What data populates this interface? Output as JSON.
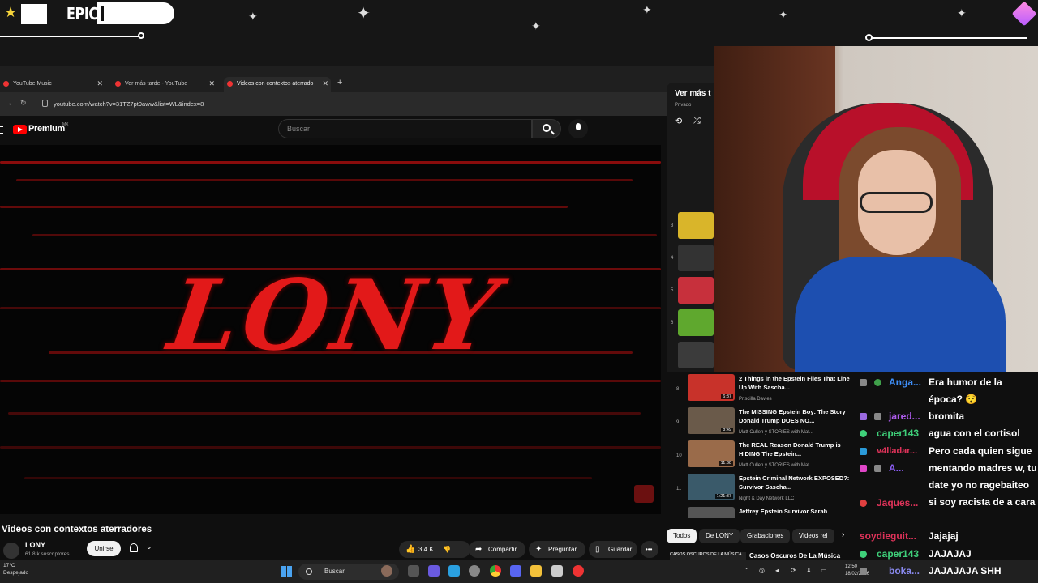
{
  "overlay": {
    "brand": "EPIC"
  },
  "browser": {
    "tabs": [
      {
        "label": "YouTube Music"
      },
      {
        "label": "Ver más tarde - YouTube"
      },
      {
        "label": "Videos con contextos aterrado"
      }
    ],
    "url": "youtube.com/watch?v=31TZ7pt9aww&list=WL&index=8"
  },
  "youtube": {
    "logo_text": "Premium",
    "region": "MX",
    "search_placeholder": "Buscar",
    "video_art_text": "LONY",
    "video_title": "Videos con contextos aterradores",
    "channel_name": "LONY",
    "channel_subs": "61.8 k suscriptores",
    "join_label": "Unirse",
    "actions": {
      "likes": "3.4 K",
      "share": "Compartir",
      "ask": "Preguntar",
      "save": "Guardar"
    }
  },
  "playlist": {
    "title": "Ver más t",
    "subtitle": "Privado",
    "items": [
      {
        "num": "3",
        "color": "#d9b52a"
      },
      {
        "num": "4",
        "color": "#333333"
      },
      {
        "num": "5",
        "color": "#c7303c"
      },
      {
        "num": "6",
        "color": "#5fa82e"
      },
      {
        "num": "",
        "color": "#3b3b3b"
      }
    ]
  },
  "recommendations": [
    {
      "num": "8",
      "title": "2 Things in the Epstein Files That Line Up With Sascha...",
      "channel": "Priscilla Davies",
      "duration": "6:37",
      "color": "#c8322a"
    },
    {
      "num": "9",
      "title": "The MISSING Epstein Boy: The Story Donald Trump DOES NO...",
      "channel": "Matt Cullen y STORIES with Mat...",
      "duration": "8:49",
      "color": "#6a5a4a"
    },
    {
      "num": "10",
      "title": "The REAL Reason Donald Trump is HIDING The Epstein...",
      "channel": "Matt Cullen y STORIES with Mat...",
      "duration": "11:30",
      "color": "#9a6b4a"
    },
    {
      "num": "11",
      "title": "Epstein Criminal Network EXPOSED?: Survivor Sascha...",
      "channel": "Night & Day Network LLC",
      "duration": "1:21:37",
      "color": "#3a5a6a"
    },
    {
      "num": "",
      "title": "Jeffrey Epstein Survivor Sarah",
      "channel": "",
      "duration": "",
      "color": "#555555"
    }
  ],
  "chips": [
    {
      "label": "Todos",
      "active": true
    },
    {
      "label": "De LONY",
      "active": false
    },
    {
      "label": "Grabaciones",
      "active": false
    },
    {
      "label": "Videos rel",
      "active": false
    }
  ],
  "bottom_rec": {
    "thumb_text": "CASOS OSCUROS DE LA MÚSICA",
    "title": "Casos Oscuros De La Música"
  },
  "chat": [
    {
      "user": "Anga...",
      "color": "#3e8ef7",
      "msg": "Era humor de la época? 😯",
      "badge": "#888888"
    },
    {
      "user": "jared...",
      "color": "#b05cf0",
      "msg": "bromita",
      "badge": "#9b6ae0"
    },
    {
      "user": "caper143",
      "color": "#3fd07a",
      "msg": "agua con el cortisol",
      "badge": "#3fd07a"
    },
    {
      "user": "v4lladar...",
      "color": "#e0335a",
      "msg": "Pero cada quien sigue mentando madres w, tu date yo no ragebaiteo si soy racista de a cara",
      "badge": "#2a9ad8"
    },
    {
      "user": "A...",
      "color": "#8a5cf0",
      "msg": "",
      "badge": "#e046c8"
    },
    {
      "user": "Jaques...",
      "color": "#e0335a",
      "msg": "",
      "badge": "#e04040"
    },
    {
      "user": "soydieguit...",
      "color": "#e0335a",
      "msg": "Jajajaj",
      "badge": ""
    },
    {
      "user": "caper143",
      "color": "#3fd07a",
      "msg": "JAJAJAJ",
      "badge": "#3fd07a"
    },
    {
      "user": "boka...",
      "color": "#8a8af0",
      "msg": "JAJAJAJA SHH",
      "badge": "#888888"
    }
  ],
  "taskbar": {
    "temperature": "17°C",
    "weather": "Despejado",
    "search": "Buscar",
    "time": "12:50",
    "date": "18/02/2026"
  }
}
